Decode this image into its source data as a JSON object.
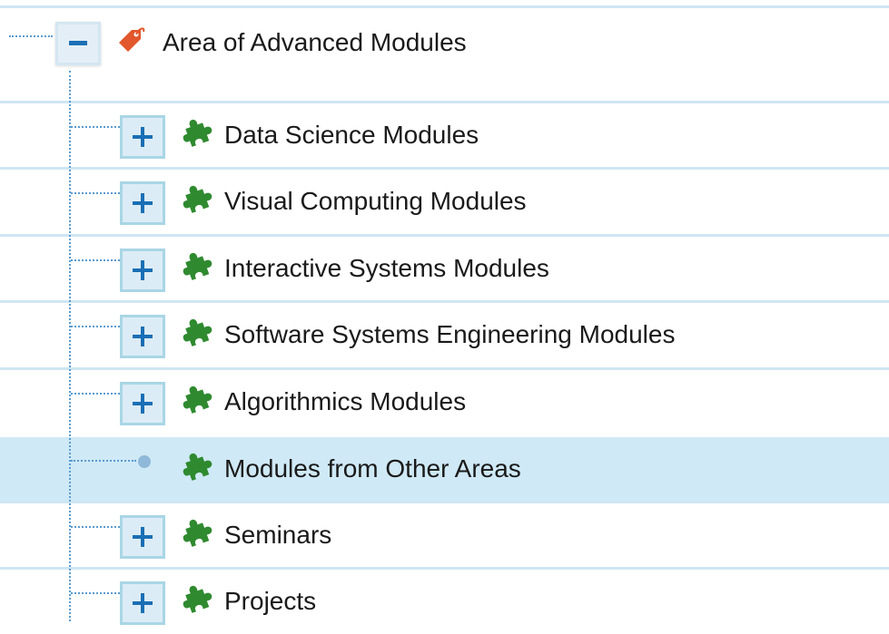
{
  "root": {
    "label": "Area of Advanced Modules",
    "icon": "tag-icon",
    "expanded": true
  },
  "children": [
    {
      "label": "Data Science Modules",
      "icon": "puzzle-icon",
      "expandable": true,
      "selected": false
    },
    {
      "label": "Visual Computing Modules",
      "icon": "puzzle-icon",
      "expandable": true,
      "selected": false
    },
    {
      "label": "Interactive Systems Modules",
      "icon": "puzzle-icon",
      "expandable": true,
      "selected": false
    },
    {
      "label": "Software Systems Engineering Modules",
      "icon": "puzzle-icon",
      "expandable": true,
      "selected": false
    },
    {
      "label": "Algorithmics Modules",
      "icon": "puzzle-icon",
      "expandable": true,
      "selected": false
    },
    {
      "label": "Modules from Other Areas",
      "icon": "puzzle-icon",
      "expandable": false,
      "selected": true
    },
    {
      "label": "Seminars",
      "icon": "puzzle-icon",
      "expandable": true,
      "selected": false
    },
    {
      "label": "Projects",
      "icon": "puzzle-icon",
      "expandable": true,
      "selected": false
    }
  ],
  "colors": {
    "tag": "#e2572b",
    "puzzle": "#2f8a2f",
    "toggle_sign": "#1a6fb5",
    "selected_row": "#cfe9f6",
    "connector": "#5a9bd0"
  }
}
